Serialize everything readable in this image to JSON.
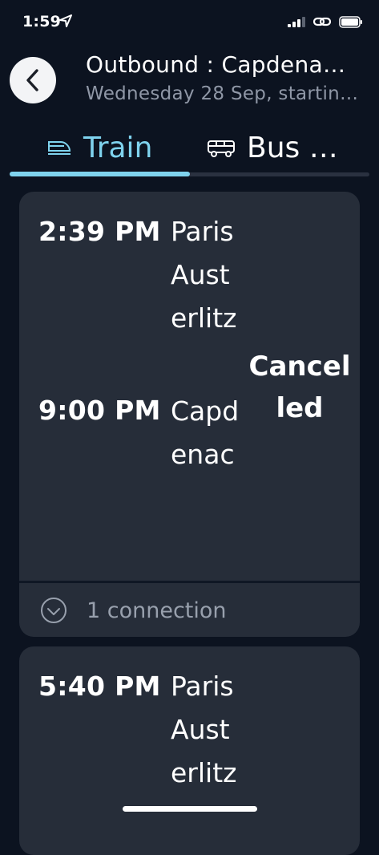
{
  "status_bar": {
    "time": "1:59"
  },
  "header": {
    "back_icon": "chevron-left-icon",
    "title": "Outbound : Capdena…",
    "subtitle": "Wednesday 28 Sep, startin…"
  },
  "tabs": [
    {
      "label": "Train",
      "icon": "train-icon",
      "active": true
    },
    {
      "label": "Bus …",
      "icon": "bus-icon",
      "active": false
    }
  ],
  "colors": {
    "background": "#0c1320",
    "card": "#262d39",
    "accent": "#7fd3ee",
    "muted": "#98a0ad"
  },
  "journeys": [
    {
      "departure_time": "2:39 PM",
      "departure_station": "Paris Austerlitz",
      "arrival_time": "9:00 PM",
      "arrival_station": "Capdenac",
      "status": "Cancelled",
      "connections": "1 connection"
    },
    {
      "departure_time": "5:40 PM",
      "departure_station": "Paris Austerlitz"
    }
  ]
}
